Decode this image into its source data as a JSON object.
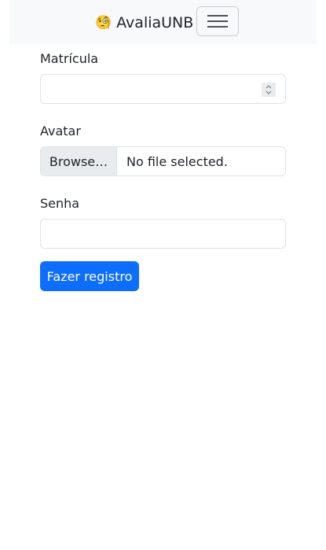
{
  "navbar": {
    "brand_emoji": "🧐",
    "brand_text": "AvaliaUNB",
    "toggler_icon": "hamburger-menu-icon"
  },
  "form": {
    "matricula": {
      "label": "Matrícula",
      "value": ""
    },
    "avatar": {
      "label": "Avatar",
      "button_label": "Browse…",
      "status_text": "No file selected."
    },
    "senha": {
      "label": "Senha",
      "value": ""
    },
    "submit_label": "Fazer registro"
  },
  "colors": {
    "primary": "#0d6efd",
    "navbar_bg": "#f8f9fa",
    "border": "#dee2e6"
  }
}
